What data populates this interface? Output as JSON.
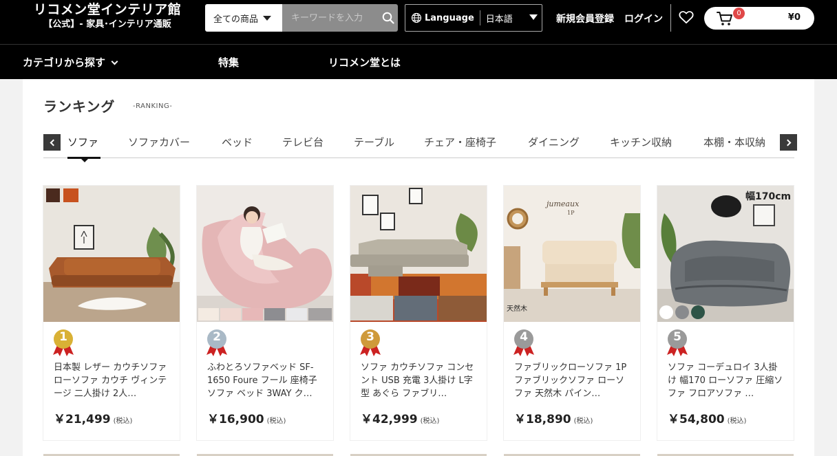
{
  "header": {
    "logo_title": "リコメン堂インテリア館",
    "logo_subtitle": "【公式】- 家具･インテリア通販",
    "search_category": "全ての商品",
    "search_placeholder": "キーワードを入力",
    "language_label": "Language",
    "language_value": "日本語",
    "register_label": "新規会員登録",
    "login_label": "ログイン",
    "cart_count": "0",
    "cart_total": "¥0"
  },
  "nav": {
    "items": [
      {
        "label": "カテゴリから探す"
      },
      {
        "label": "特集"
      },
      {
        "label": "リコメン堂とは"
      }
    ]
  },
  "ranking": {
    "title": "ランキング",
    "subtitle": "-RANKING-",
    "tabs": [
      {
        "label": "ソファ"
      },
      {
        "label": "ソファカバー"
      },
      {
        "label": "ベッド"
      },
      {
        "label": "テレビ台"
      },
      {
        "label": "テーブル"
      },
      {
        "label": "チェア・座椅子"
      },
      {
        "label": "ダイニング"
      },
      {
        "label": "キッチン収納"
      },
      {
        "label": "本棚・本収納"
      }
    ],
    "products": [
      {
        "rank": "1",
        "name": "日本製 レザー カウチソファ ローソファ カウチ ヴィンテージ 二人掛け 2人…",
        "price": "￥21,499",
        "tax": "(税込)"
      },
      {
        "rank": "2",
        "name": "ふわとろソファベッド SF-1650 Foure フール 座椅子 ソファ ベッド 3WAY ク…",
        "price": "￥16,900",
        "tax": "(税込)"
      },
      {
        "rank": "3",
        "name": "ソファ カウチソファ コンセント USB 充電 3人掛け L字型 あぐら ファブリ…",
        "price": "￥42,999",
        "tax": "(税込)"
      },
      {
        "rank": "4",
        "name": "ファブリックローソファ 1P ファブリックソファ ローソファ 天然木 パイン…",
        "price": "￥18,890",
        "tax": "(税込)"
      },
      {
        "rank": "5",
        "name": "ソファ コーデュロイ 3人掛け 幅170 ローソファ 圧縮ソファ フロアソファ …",
        "price": "￥54,800",
        "tax": "(税込)"
      }
    ],
    "image_overlays": {
      "p4_brand": "jumeaux",
      "p4_model": "1P",
      "p4_note": "天然木",
      "p5_width": "幅170cm"
    },
    "medal_colors": [
      "#d9b135",
      "#a9b9c6",
      "#cf9a3a",
      "#9a9a9a",
      "#9a9a9a"
    ]
  }
}
